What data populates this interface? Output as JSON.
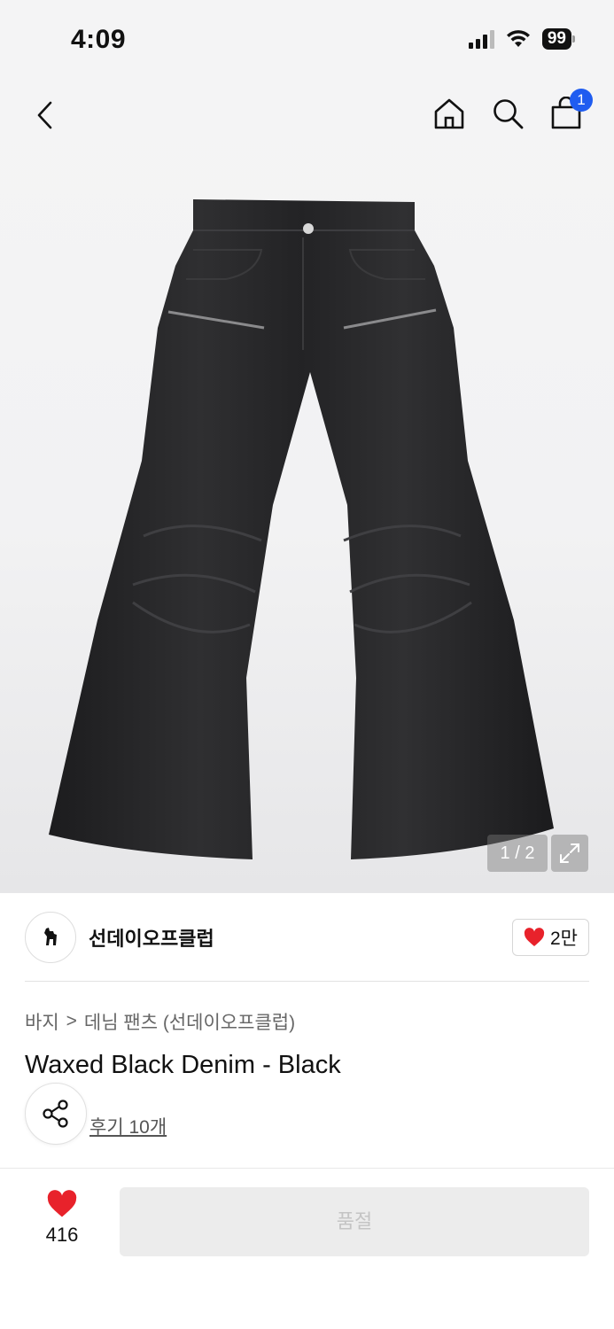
{
  "status_bar": {
    "time": "4:09",
    "battery": "99"
  },
  "nav": {
    "cart_count": "1"
  },
  "gallery": {
    "counter": "1 / 2"
  },
  "brand": {
    "name": "선데이오프클럽",
    "like_count": "2만"
  },
  "product": {
    "breadcrumb": {
      "category": "바지",
      "separator": ">",
      "subcategory": "데님 팬츠 (선데이오프클럽)"
    },
    "title": "Waxed Black Denim - Black",
    "reviews": "후기 10개"
  },
  "bottom_bar": {
    "wish_count": "416",
    "action_label": "품절"
  },
  "colors": {
    "accent_red": "#e8222b",
    "badge_blue": "#1f5cf0",
    "disabled_bg": "#ececec",
    "disabled_text": "#c4c4c4"
  },
  "icons": [
    "back-chevron-icon",
    "home-icon",
    "search-icon",
    "shopping-bag-icon",
    "expand-icon",
    "brand-logo-icon",
    "heart-icon",
    "share-icon"
  ]
}
